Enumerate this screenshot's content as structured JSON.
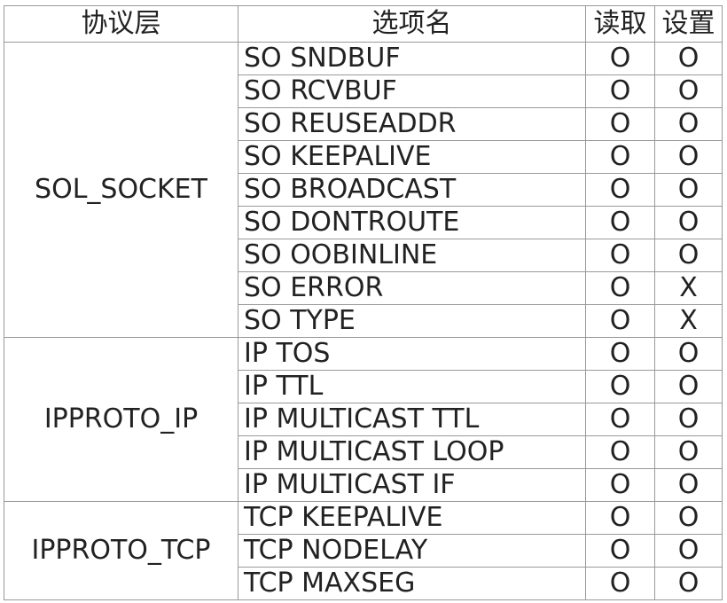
{
  "header": {
    "level": "协议层",
    "option": "选项名",
    "get": "读取",
    "set": "设置"
  },
  "groups": [
    {
      "level": "SOL_SOCKET",
      "rows": [
        {
          "option": "SO SNDBUF",
          "get": "O",
          "set": "O"
        },
        {
          "option": "SO RCVBUF",
          "get": "O",
          "set": "O"
        },
        {
          "option": "SO REUSEADDR",
          "get": "O",
          "set": "O"
        },
        {
          "option": "SO KEEPALIVE",
          "get": "O",
          "set": "O"
        },
        {
          "option": "SO BROADCAST",
          "get": "O",
          "set": "O"
        },
        {
          "option": "SO DONTROUTE",
          "get": "O",
          "set": "O"
        },
        {
          "option": "SO OOBINLINE",
          "get": "O",
          "set": "O"
        },
        {
          "option": "SO ERROR",
          "get": "O",
          "set": "X"
        },
        {
          "option": "SO TYPE",
          "get": "O",
          "set": "X"
        }
      ]
    },
    {
      "level": "IPPROTO_IP",
      "rows": [
        {
          "option": "IP TOS",
          "get": "O",
          "set": "O"
        },
        {
          "option": "IP TTL",
          "get": "O",
          "set": "O"
        },
        {
          "option": "IP MULTICAST TTL",
          "get": "O",
          "set": "O"
        },
        {
          "option": "IP MULTICAST LOOP",
          "get": "O",
          "set": "O"
        },
        {
          "option": "IP MULTICAST IF",
          "get": "O",
          "set": "O"
        }
      ]
    },
    {
      "level": "IPPROTO_TCP",
      "rows": [
        {
          "option": "TCP KEEPALIVE",
          "get": "O",
          "set": "O"
        },
        {
          "option": "TCP NODELAY",
          "get": "O",
          "set": "O"
        },
        {
          "option": "TCP MAXSEG",
          "get": "O",
          "set": "O"
        }
      ]
    }
  ]
}
